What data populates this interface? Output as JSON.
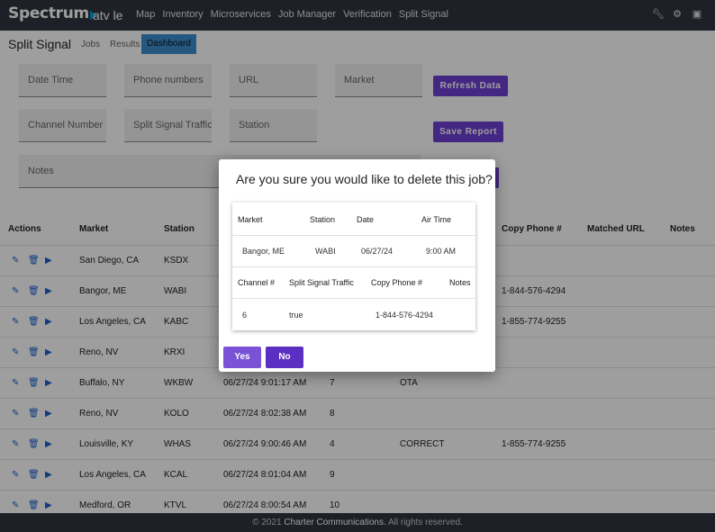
{
  "brand": {
    "logo_text": "Spectrum",
    "app_name": "atv le"
  },
  "nav": {
    "items": [
      "Map",
      "Inventory",
      "Microservices",
      "Job Manager",
      "Verification",
      "Split Signal"
    ]
  },
  "nav_icons": [
    "wrench-icon",
    "gear-icon",
    "book-icon"
  ],
  "subnav": {
    "title": "Split Signal",
    "tabs": [
      "Jobs",
      "Results",
      "Dashboard"
    ],
    "active_tab": "Dashboard"
  },
  "filters": {
    "date_time": "Date Time",
    "phone_numbers": "Phone numbers",
    "url": "URL",
    "market": "Market",
    "channel_number": "Channel Number",
    "split_signal_traffic": "Split Signal Traffic",
    "station": "Station",
    "notes": "Notes"
  },
  "buttons": {
    "refresh": "Refresh Data",
    "save_report": "Save Report"
  },
  "table": {
    "headers": [
      "Actions",
      "Market",
      "Station",
      "Copy Phone #",
      "Matched URL",
      "Notes"
    ],
    "rows": [
      {
        "market": "San Diego, CA",
        "station": "KSDX",
        "datetime": "",
        "channel": "",
        "traffic": "",
        "phone": ""
      },
      {
        "market": "Bangor, ME",
        "station": "WABI",
        "datetime": "",
        "channel": "",
        "traffic": "",
        "phone": "1-844-576-4294"
      },
      {
        "market": "Los Angeles, CA",
        "station": "KABC",
        "datetime": "",
        "channel": "",
        "traffic": "",
        "phone": "1-855-774-9255"
      },
      {
        "market": "Reno, NV",
        "station": "KRXI",
        "datetime": "",
        "channel": "",
        "traffic": "",
        "phone": ""
      },
      {
        "market": "Buffalo, NY",
        "station": "WKBW",
        "datetime": "06/27/24 9:01:17 AM",
        "channel": "7",
        "traffic": "OTA",
        "phone": ""
      },
      {
        "market": "Reno, NV",
        "station": "KOLO",
        "datetime": "06/27/24 8:02:38 AM",
        "channel": "8",
        "traffic": "",
        "phone": ""
      },
      {
        "market": "Louisville, KY",
        "station": "WHAS",
        "datetime": "06/27/24 9:00:46 AM",
        "channel": "4",
        "traffic": "CORRECT",
        "phone": "1-855-774-9255"
      },
      {
        "market": "Los Angeles, CA",
        "station": "KCAL",
        "datetime": "06/27/24 8:01:04 AM",
        "channel": "9",
        "traffic": "",
        "phone": ""
      },
      {
        "market": "Medford, OR",
        "station": "KTVL",
        "datetime": "06/27/24 8:00:54 AM",
        "channel": "10",
        "traffic": "",
        "phone": ""
      }
    ]
  },
  "footer": {
    "copyright": "©",
    "year": "2021",
    "company": "Charter Communications.",
    "rights": "All rights reserved."
  },
  "modal": {
    "title": "Are you sure you would like to delete this job?",
    "headers1": [
      "Market",
      "Station",
      "Date",
      "Air Time"
    ],
    "values1": [
      "Bangor, ME",
      "WABI",
      "06/27/24",
      "9:00 AM"
    ],
    "headers2": [
      "Channel #",
      "Split Signal Traffic",
      "Copy Phone #",
      "Notes"
    ],
    "values2": [
      "6",
      "true",
      "1-844-576-4294",
      ""
    ],
    "yes": "Yes",
    "no": "No"
  },
  "colors": {
    "nav_bg": "#2f3640",
    "accent": "#6d3fd3",
    "active_tab": "#3d8fd1",
    "action_icon": "#1a5fd0"
  }
}
